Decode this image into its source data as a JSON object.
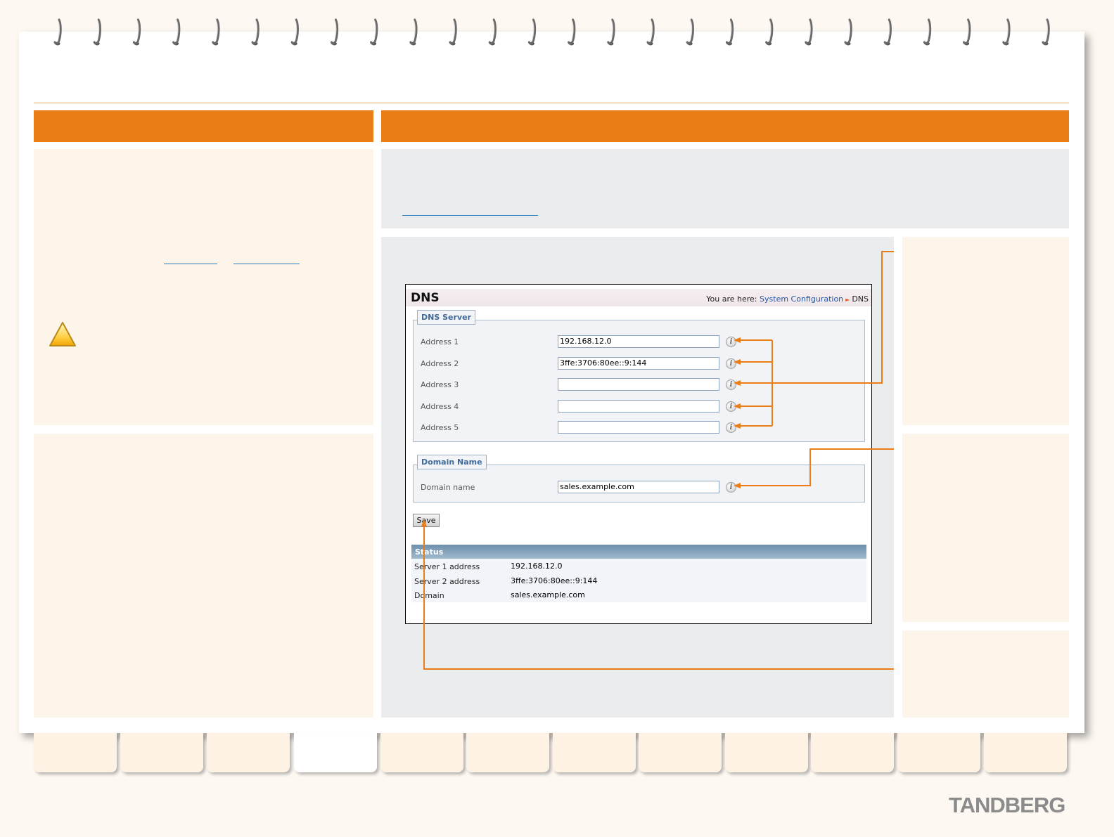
{
  "window": {
    "title": "DNS",
    "breadcrumb": {
      "prefix": "You are here:",
      "link": "System Configuration",
      "current": "DNS"
    }
  },
  "dns_server": {
    "legend": "DNS Server",
    "addresses": [
      {
        "label": "Address 1",
        "value": "192.168.12.0"
      },
      {
        "label": "Address 2",
        "value": "3ffe:3706:80ee::9:144"
      },
      {
        "label": "Address 3",
        "value": ""
      },
      {
        "label": "Address 4",
        "value": ""
      },
      {
        "label": "Address 5",
        "value": ""
      }
    ]
  },
  "domain_name": {
    "legend": "Domain Name",
    "label": "Domain name",
    "value": "sales.example.com"
  },
  "save_label": "Save",
  "status": {
    "title": "Status",
    "rows": [
      {
        "key": "Server 1 address",
        "value": "192.168.12.0"
      },
      {
        "key": "Server 2 address",
        "value": "3ffe:3706:80ee::9:144"
      },
      {
        "key": "Domain",
        "value": "sales.example.com"
      }
    ]
  },
  "icons": {
    "info": "i",
    "warning": "warning-icon"
  },
  "colors": {
    "accent": "#ea7d16",
    "callout": "#ea7d16",
    "link": "#2a7ab8"
  },
  "brand": "TANDBERG"
}
